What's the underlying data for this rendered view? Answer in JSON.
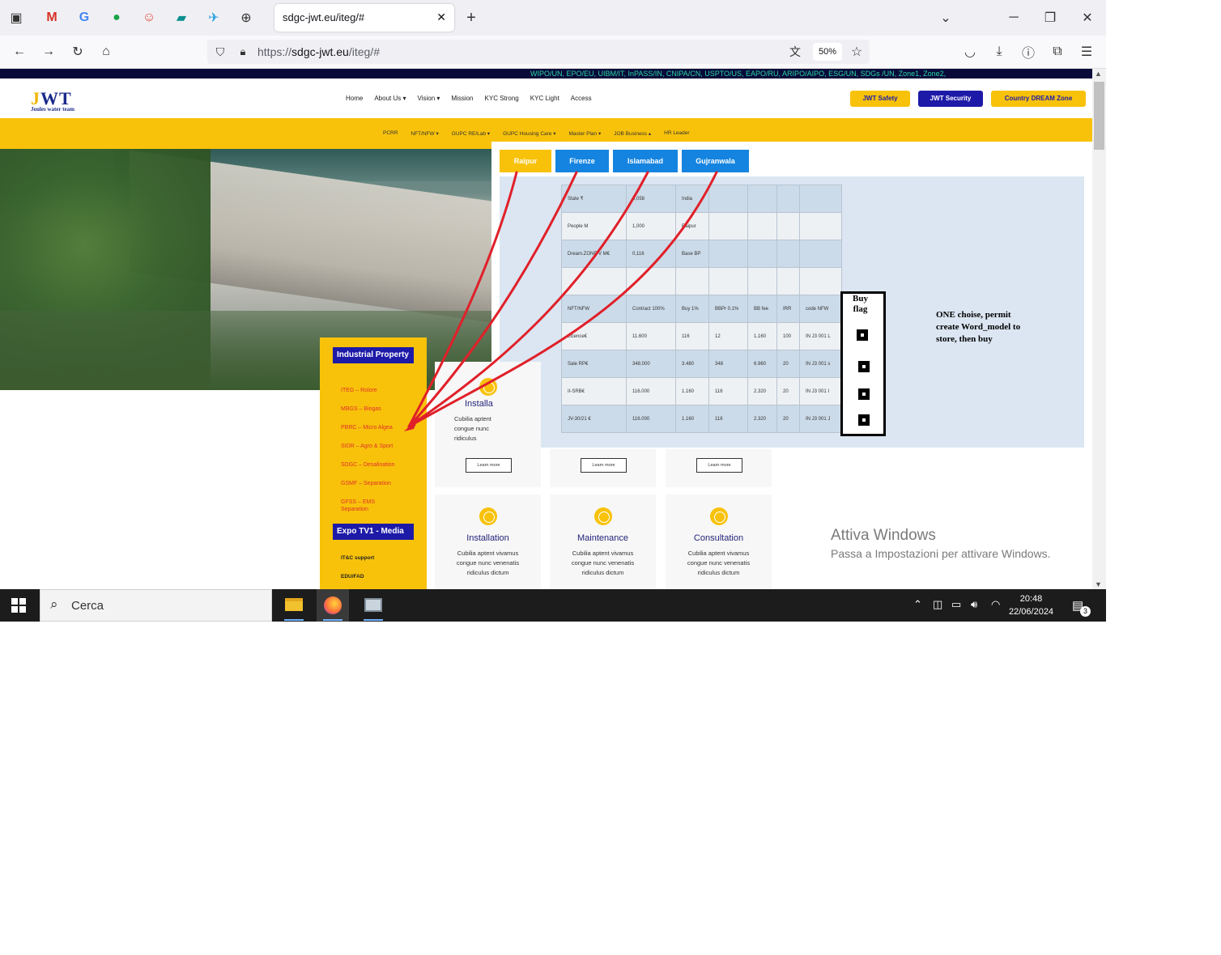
{
  "browser": {
    "tab_title": "sdgc-jwt.eu/iteg/#",
    "url_prefix": "https://",
    "url_domain": "sdgc-jwt.eu",
    "url_path": "/iteg/#",
    "zoom": "50%"
  },
  "site": {
    "ticker": "WIPO/UN, EPO/EU, UIBM/IT, InPASS/IN, CNIPA/CN, USPTO/US, EAPO/RU, ARIPO/AIPO, ESG/UN, SDGs /UN, Zone1, Zone2,",
    "logo_main_j": "J",
    "logo_main_rest": "WT",
    "logo_sub": "Joules water team",
    "nav": [
      "Home",
      "About Us ▾",
      "Vision ▾",
      "Mission",
      "KYC Strong",
      "KYC Light",
      "Access"
    ],
    "buttons": {
      "safety": "JWT Safety",
      "security": "JWT Security",
      "dream": "Country DREAM Zone"
    },
    "colors": {
      "yellow": "#f8c20a",
      "navy": "#1d1aa8",
      "blue": "#1584e0",
      "red": "#e0312b"
    },
    "subnav": [
      "PCRR",
      "NFT/NFW ▾",
      "GUPC RE/Lab ▾",
      "GUPC Housing Care ▾",
      "Master Plan ▾",
      "JOB Business ▴",
      "HR Leader"
    ]
  },
  "city_tabs": [
    "Raipur",
    "Firenze",
    "Islamabad",
    "Gujranwala"
  ],
  "grid": {
    "rows": [
      [
        "State ₹",
        "0,058",
        "India",
        "",
        "",
        "",
        ""
      ],
      [
        "People M",
        "1,000",
        "Raipur",
        "",
        "",
        "",
        ""
      ],
      [
        "Dream.ZONE V M€",
        "0,116",
        "Base BP",
        "",
        "",
        "",
        ""
      ],
      [
        "",
        "",
        "",
        "",
        "",
        "",
        ""
      ],
      [
        "NFT/NFW",
        "Contract 100%",
        "Buy 1%",
        "BBPr 0.1%",
        "BB fee",
        "IRR",
        "code NFW"
      ],
      [
        "Licence€",
        "11.600",
        "116",
        "12",
        "1.160",
        "100",
        "IN J3 001 L"
      ],
      [
        "Sale RP€",
        "348.000",
        "3.480",
        "348",
        "6.960",
        "20",
        "IN J3 001 s"
      ],
      [
        "II-SRB€",
        "116.000",
        "1.160",
        "116",
        "2.320",
        "20",
        "IN J3 001 I"
      ],
      [
        "JV-30/21 €",
        "116.000",
        "1.160",
        "116",
        "2.320",
        "20",
        "IN J3 001 J"
      ]
    ]
  },
  "buy_flag": {
    "title_line1": "Buy",
    "title_line2": "flag"
  },
  "note": "ONE choise, permit create Word_model to store, then buy",
  "sidebar": {
    "heading1": "Industrial Property",
    "links": [
      "ITEG – Rolore",
      "MBGS – Biogas",
      "PBRC – Micro Algea",
      "SIDR – Agro & Sport",
      "SDGC – Desalination",
      "GSMF – Separation",
      "GFSS – EMS Separation"
    ],
    "heading2": "Expo TV1 - Media",
    "links2": [
      "IT&C support",
      "EDU/FAD"
    ]
  },
  "cards_partial": {
    "title": "Installa",
    "text": [
      "Cubilia aptent",
      "congue nunc",
      "ridiculus"
    ]
  },
  "learn_more": "Learn more",
  "cards": [
    {
      "title": "Installation",
      "text1": "Cubilia aptent vivamus",
      "text2": "congue nunc venenatis",
      "text3": "ridiculus dictum"
    },
    {
      "title": "Maintenance",
      "text1": "Cubilia aptent vivamus",
      "text2": "congue nunc venenatis",
      "text3": "ridiculus dictum"
    },
    {
      "title": "Consultation",
      "text1": "Cubilia aptent vivamus",
      "text2": "congue nunc venenatis",
      "text3": "ridiculus dictum"
    }
  ],
  "watermark": {
    "line1": "Attiva Windows",
    "line2": "Passa a Impostazioni per attivare Windows."
  },
  "taskbar": {
    "search_placeholder": "Cerca",
    "time": "20:48",
    "date": "22/06/2024",
    "notif_count": "3"
  }
}
